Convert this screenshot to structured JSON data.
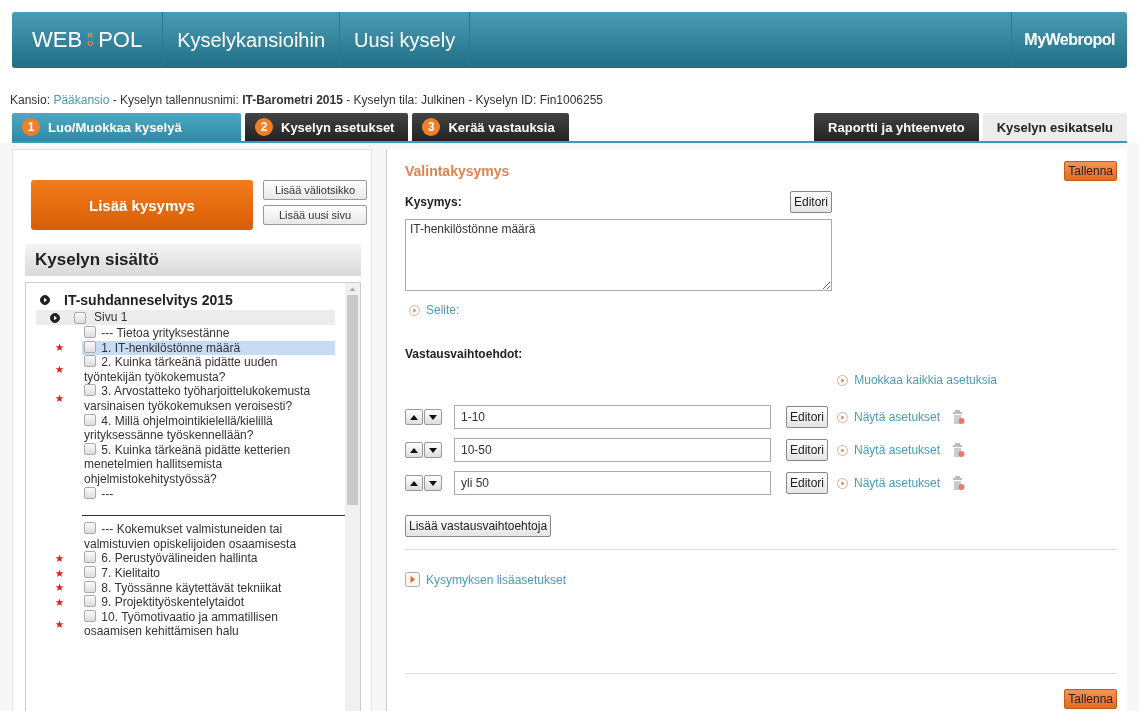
{
  "header": {
    "logo": [
      "WEB",
      "RO",
      "POL"
    ],
    "nav": [
      {
        "label": "Kyselykansioihin"
      },
      {
        "label": "Uusi kysely"
      }
    ],
    "user_menu": "MyWebropol"
  },
  "breadcrumb": [
    {
      "kind": "plain",
      "text": "Kansio:"
    },
    {
      "kind": "link",
      "text": "Pääkansio"
    },
    {
      "kind": "plain",
      "text": "- Kyselyn tallennusnimi:"
    },
    {
      "kind": "bold",
      "text": "IT-Barometri 2015"
    },
    {
      "kind": "plain",
      "text": "- Kyselyn tila: Julkinen - Kyselyn ID: Fin1006255"
    }
  ],
  "steps": [
    {
      "number": "1",
      "label": "Luo/Muokkaa kyselyä",
      "selected": true
    },
    {
      "number": "2",
      "label": "Kyselyn asetukset",
      "selected": false
    },
    {
      "number": "3",
      "label": "Kerää vastauksia",
      "selected": false
    }
  ],
  "right_tabs": [
    {
      "label": "Raportti ja yhteenveto",
      "kind": "dark"
    },
    {
      "label": "Kyselyn esikatselu",
      "kind": "light"
    }
  ],
  "left": {
    "add_question": "Lisää kysymys",
    "add_heading": "Lisää väliotsikko",
    "add_page": "Lisää uusi sivu",
    "contents_title": "Kyselyn sisältö",
    "tree": [
      {
        "kind": "survey",
        "label": "IT-suhdanneselvitys 2015",
        "expanded": true,
        "children": [
          {
            "kind": "page",
            "label": "Sivu 1",
            "expanded": true,
            "checked": false,
            "children": [
              {
                "kind": "item",
                "label": "--- Tietoa yrityksestänne",
                "checked": false,
                "required": false,
                "selected": false
              },
              {
                "kind": "item",
                "label": "1. IT-henkilöstönne määrä",
                "checked": false,
                "required": true,
                "selected": true
              },
              {
                "kind": "item",
                "label": "2. Kuinka tärkeänä pidätte uuden työntekijän työkokemusta?",
                "checked": false,
                "required": true,
                "selected": false
              },
              {
                "kind": "item",
                "label": "3. Arvostatteko työharjoittelukokemusta varsinaisen työkokemuksen veroisesti?",
                "checked": false,
                "required": true,
                "selected": false
              },
              {
                "kind": "item",
                "label": "4. Millä ohjelmointikielellä/kielillä yrityksessänne työskennellään?",
                "checked": false,
                "required": false,
                "selected": false
              },
              {
                "kind": "item",
                "label": "5. Kuinka tärkeänä pidätte ketterien menetelmien hallitsemista ohjelmistokehitystyössä?",
                "checked": false,
                "required": false,
                "selected": false
              },
              {
                "kind": "item",
                "label": "---",
                "checked": false,
                "required": false,
                "selected": false
              },
              {
                "kind": "break"
              },
              {
                "kind": "item",
                "label": "--- Kokemukset valmistuneiden tai valmistuvien opiskelijoiden osaamisesta",
                "checked": false,
                "required": false,
                "selected": false
              },
              {
                "kind": "item",
                "label": "6. Perustyövälineiden hallinta",
                "checked": false,
                "required": true,
                "selected": false
              },
              {
                "kind": "item",
                "label": "7. Kielitaito",
                "checked": false,
                "required": true,
                "selected": false
              },
              {
                "kind": "item",
                "label": "8. Työssänne käytettävät tekniikat",
                "checked": false,
                "required": true,
                "selected": false
              },
              {
                "kind": "item",
                "label": "9. Projektityöskentelytaidot",
                "checked": false,
                "required": true,
                "selected": false
              },
              {
                "kind": "item",
                "label": "10. Työmotivaatio ja ammatillisen osaamisen kehittämisen halu",
                "checked": false,
                "required": true,
                "selected": false
              }
            ]
          }
        ]
      }
    ]
  },
  "editor": {
    "type_title": "Valintakysymys",
    "save_top": "Tallenna",
    "question_label": "Kysymys:",
    "question_editor": "Editori",
    "question_text": "IT-henkilöstönne määrä",
    "description_link": "Selite:",
    "options_label": "Vastausvaihtoehdot:",
    "edit_all": "Muokkaa kaikkia asetuksia",
    "options": [
      {
        "value": "1-10",
        "editor": "Editori",
        "settings": "Näytä asetukset"
      },
      {
        "value": "10-50",
        "editor": "Editori",
        "settings": "Näytä asetukset"
      },
      {
        "value": "yli 50",
        "editor": "Editori",
        "settings": "Näytä asetukset"
      }
    ],
    "add_options": "Lisää vastausvaihtoehtoja",
    "advanced": "Kysymyksen lisäasetukset",
    "save_bottom": "Tallenna"
  }
}
